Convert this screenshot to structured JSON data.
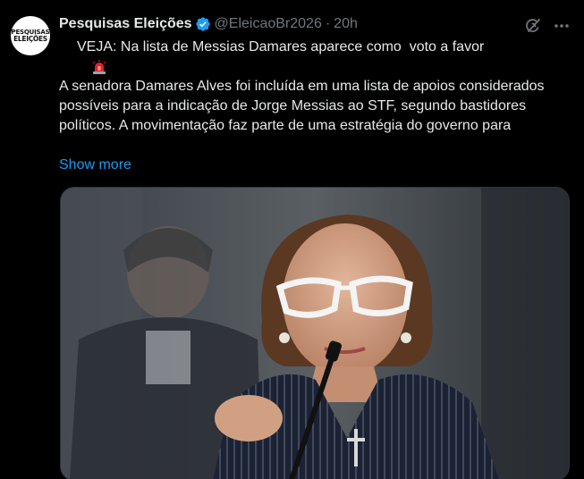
{
  "account": {
    "avatar_line1": "PESQUISAS",
    "avatar_line2": "ELEIÇÕES",
    "name": "Pesquisas Eleições",
    "handle": "@EleicaoBr2026",
    "separator": "·",
    "time": "20h",
    "verified_color": "#1d9bf0"
  },
  "tweet": {
    "headline": "VEJA: Na lista de Messias Damares aparece como  voto a favor",
    "body": "A senadora Damares Alves foi incluída em uma lista de apoios considerados possíveis para a indicação de Jorge Messias ao STF, segundo bastidores políticos. A movimentação faz parte de uma estratégia do governo para",
    "show_more": "Show more",
    "headline_icon": "siren-icon"
  },
  "icons": {
    "grok": "grok-icon",
    "more": "more-icon"
  },
  "colors": {
    "background": "#000000",
    "text": "#e7e9ea",
    "muted": "#71767b",
    "link": "#1d9bf0"
  }
}
